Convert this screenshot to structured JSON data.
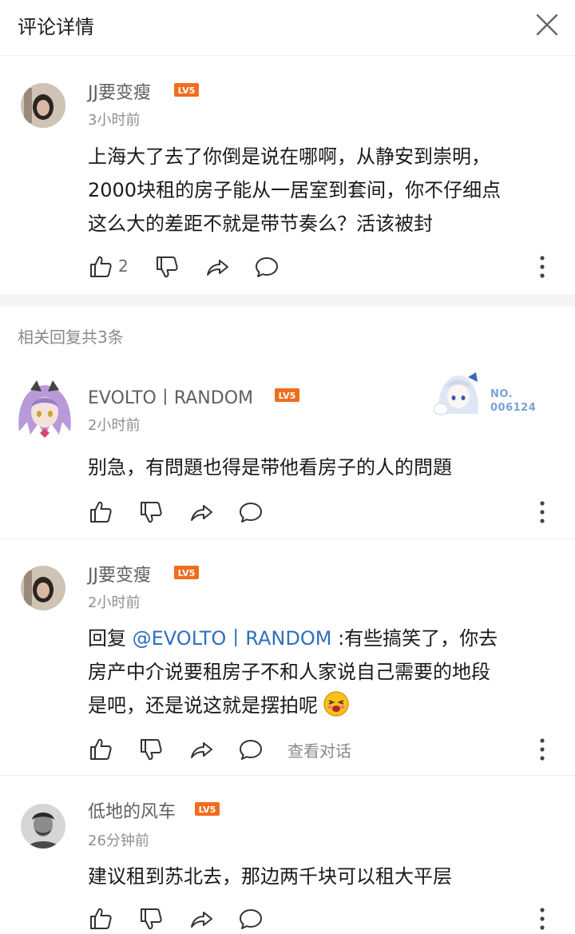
{
  "header": {
    "title": "评论详情",
    "close_icon": "close-icon"
  },
  "main_comment": {
    "username": "JJ要变瘦",
    "level": "LV5",
    "time": "3小时前",
    "lines": [
      "上海大了去了你倒是说在哪啊，从静安到崇明，",
      "2000块租的房子能从一居室到套间，你不仔细点",
      "这么大的差距不就是带节奏么？活该被封"
    ],
    "likes": "2"
  },
  "replies_header": "相关回复共3条",
  "replies": [
    {
      "username": "EVOLTO丨RANDOM",
      "level": "LV5",
      "time": "2小时前",
      "badge_line1": "NO.",
      "badge_line2": "006124",
      "lines": [
        "别急，有問題也得是带他看房子的人的問題"
      ]
    },
    {
      "username": "JJ要变瘦",
      "level": "LV5",
      "time": "2小时前",
      "reply_prefix": "回复 ",
      "mention": "@EVOLTO丨RANDOM",
      "line1_rest": " :有些搞笑了，你去",
      "line2": "房产中介说要租房子不和人家说自己需要的地段",
      "line3": "是吧，还是说这就是摆拍呢",
      "view_conversation": "查看对话"
    },
    {
      "username": "低地的风车",
      "level": "LV5",
      "time": "26分钟前",
      "lines": [
        "建议租到苏北去，那边两千块可以租大平层"
      ]
    }
  ],
  "colors": {
    "accent": "#f06d1f",
    "link": "#2f6fbd",
    "text": "#1a1a1a",
    "muted": "#8f8f8f",
    "level_badge": "#f06d1f"
  },
  "icons": [
    "like-icon",
    "dislike-icon",
    "share-icon",
    "reply-icon",
    "more-icon",
    "emoji-icon"
  ]
}
